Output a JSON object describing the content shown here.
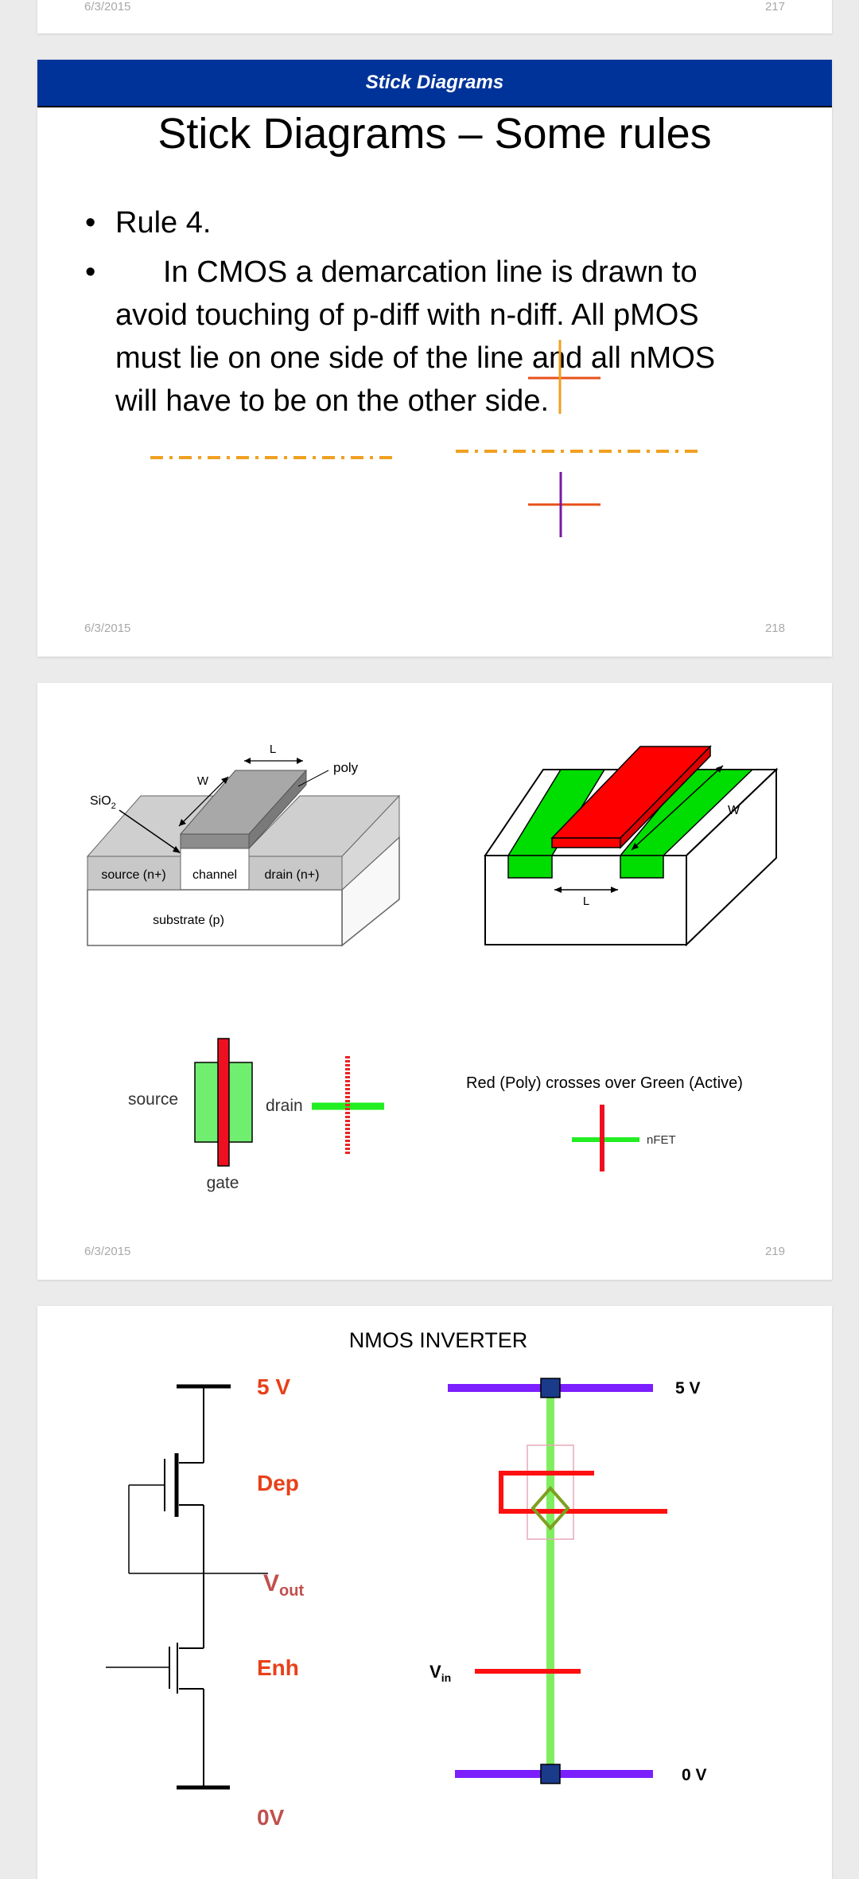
{
  "page1": {
    "date": "6/3/2015",
    "number": "217"
  },
  "page2": {
    "banner": "Stick Diagrams",
    "title": "Stick Diagrams – Some rules",
    "bullet1": "Rule 4.",
    "bullet2_line1": "In CMOS a demarcation line is drawn to",
    "bullet2_line2": "avoid touching of p-diff with n-diff. All pMOS",
    "bullet2_line3": "must lie on one side of the line and all nMOS",
    "bullet2_line4": "will have to be on the other side.",
    "date": "6/3/2015",
    "number": "218",
    "colors": {
      "banner": "#003399",
      "dash": "#f0a020",
      "cross_h": "#e8501a",
      "cross_v": "#7a1aa0"
    }
  },
  "page3": {
    "left_fig": {
      "L": "L",
      "W": "W",
      "poly": "poly",
      "sio2": "SiO",
      "sio2_sub": "2",
      "source": "source (n+)",
      "channel": "channel",
      "drain": "drain (n+)",
      "substrate": "substrate (p)"
    },
    "right_fig": {
      "W": "W",
      "L": "L"
    },
    "symbol": {
      "source": "source",
      "drain": "drain",
      "gate": "gate"
    },
    "caption": "Red (Poly) crosses over Green (Active)",
    "nfet": "nFET",
    "date": "6/3/2015",
    "number": "219",
    "colors": {
      "poly": "#ff0000",
      "active": "#00cc00"
    }
  },
  "page4": {
    "title": "NMOS INVERTER",
    "v5": "5 V",
    "dep": "Dep",
    "vout": "V",
    "vout_sub": "out",
    "enh": "Enh",
    "zero_v": "0V",
    "stick_5v": "5 V",
    "stick_vin": "V",
    "stick_vin_sub": "in",
    "stick_0v": "0 V",
    "colors": {
      "label": "#e8401a",
      "rail": "#7b1fff",
      "diff": "#80ee60",
      "poly": "#ff1010"
    }
  }
}
